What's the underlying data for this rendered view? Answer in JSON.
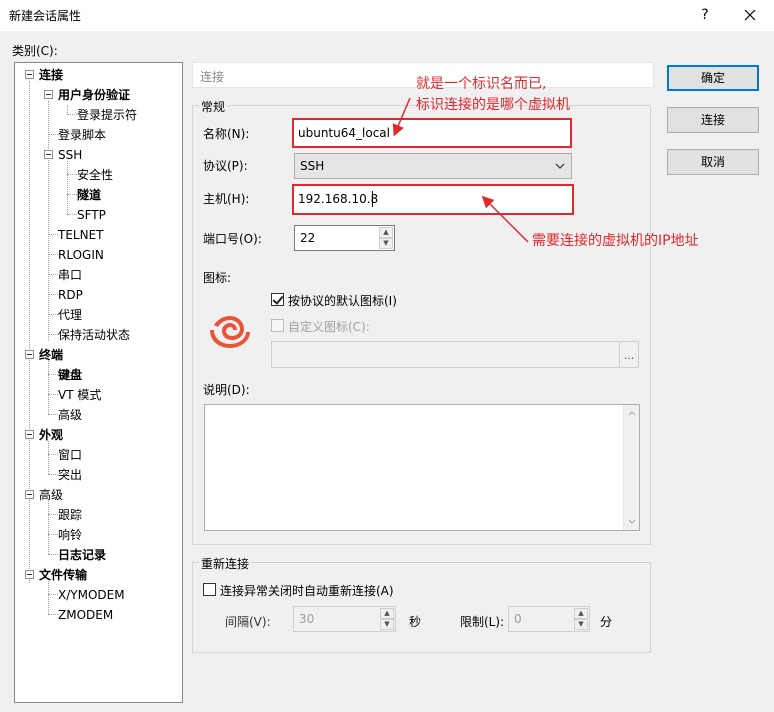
{
  "window": {
    "title": "新建会话属性",
    "help": "?",
    "close": "✕"
  },
  "category_label": "类别(C):",
  "tree": [
    {
      "label": "连接",
      "bold": true
    },
    {
      "label": "用户身份验证",
      "bold": true
    },
    {
      "label": "登录提示符",
      "bold": false
    },
    {
      "label": "登录脚本",
      "bold": false
    },
    {
      "label": "SSH",
      "bold": false
    },
    {
      "label": "安全性",
      "bold": false
    },
    {
      "label": "隧道",
      "bold": true
    },
    {
      "label": "SFTP",
      "bold": false
    },
    {
      "label": "TELNET",
      "bold": false
    },
    {
      "label": "RLOGIN",
      "bold": false
    },
    {
      "label": "串口",
      "bold": false
    },
    {
      "label": "RDP",
      "bold": false
    },
    {
      "label": "代理",
      "bold": false
    },
    {
      "label": "保持活动状态",
      "bold": false
    },
    {
      "label": "终端",
      "bold": true
    },
    {
      "label": "键盘",
      "bold": true
    },
    {
      "label": "VT 模式",
      "bold": false
    },
    {
      "label": "高级",
      "bold": false
    },
    {
      "label": "外观",
      "bold": true
    },
    {
      "label": "窗口",
      "bold": false
    },
    {
      "label": "突出",
      "bold": false
    },
    {
      "label": "高级",
      "bold": false
    },
    {
      "label": "跟踪",
      "bold": false
    },
    {
      "label": "响铃",
      "bold": false
    },
    {
      "label": "日志记录",
      "bold": true
    },
    {
      "label": "文件传输",
      "bold": true
    },
    {
      "label": "X/YMODEM",
      "bold": false
    },
    {
      "label": "ZMODEM",
      "bold": false
    }
  ],
  "header": "连接",
  "general": {
    "title": "常规",
    "name_label": "名称(N):",
    "name_value": "ubuntu64_local",
    "protocol_label": "协议(P):",
    "protocol_value": "SSH",
    "host_label": "主机(H):",
    "host_value": "192.168.10.8",
    "port_label": "端口号(O):",
    "port_value": "22",
    "icon_label": "图标:",
    "default_icon_label": "按协议的默认图标(I)",
    "custom_icon_label": "自定义图标(C):",
    "browse_label": "...",
    "desc_label": "说明(D):"
  },
  "reconnect": {
    "title": "重新连接",
    "checkbox_label": "连接异常关闭时自动重新连接(A)",
    "interval_label": "间隔(V):",
    "interval_value": "30",
    "interval_unit": "秒",
    "limit_label": "限制(L):",
    "limit_value": "0",
    "limit_unit": "分"
  },
  "buttons": {
    "ok": "确定",
    "connect": "连接",
    "cancel": "取消"
  },
  "annotations": {
    "name_note_1": "就是一个标识名而已,",
    "name_note_2": "标识连接的是哪个虚拟机",
    "host_note": "需要连接的虚拟机的IP地址"
  },
  "colors": {
    "annotation": "#e0282e",
    "logo": "#e8563a",
    "accent": "#0078d7"
  }
}
